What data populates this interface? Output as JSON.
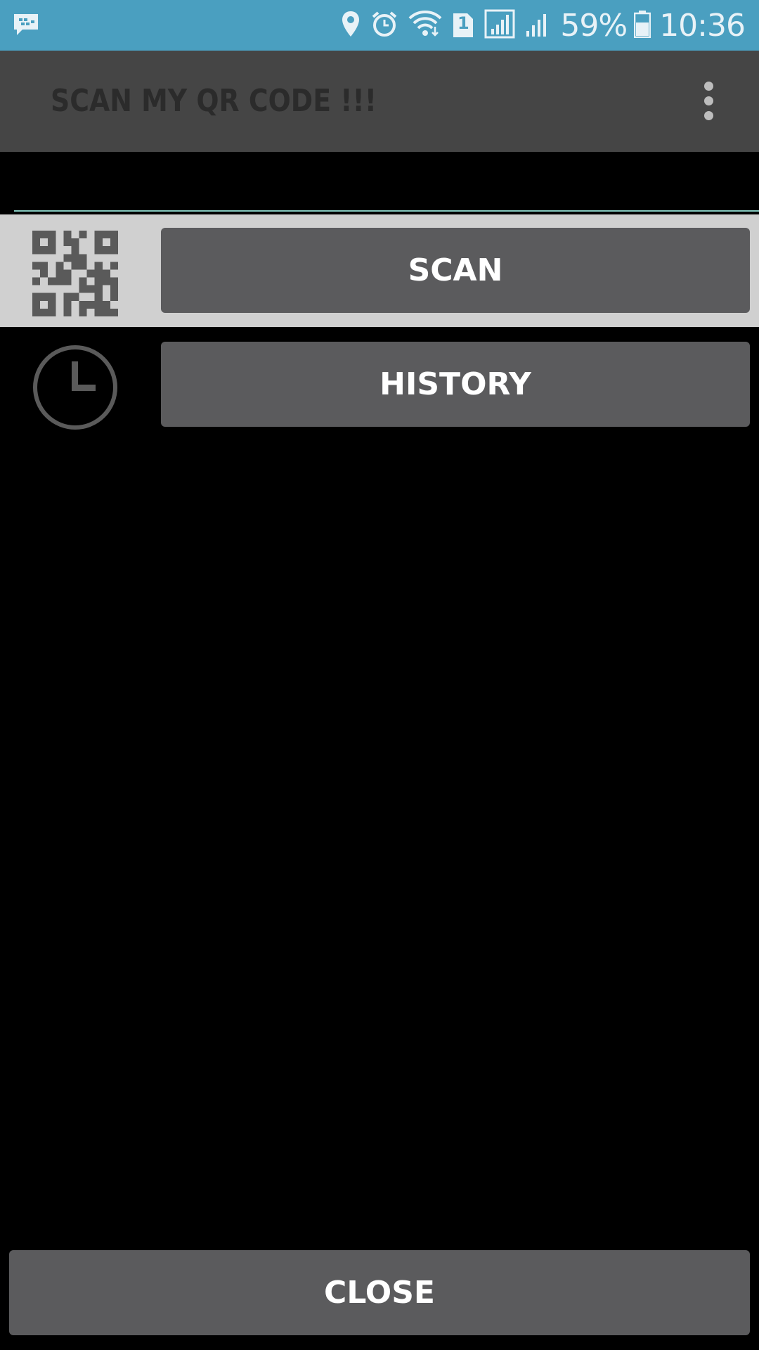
{
  "status_bar": {
    "notification_icon": "bbm-chat-icon",
    "icons": [
      "location-icon",
      "alarm-icon",
      "wifi-icon",
      "sim-1-icon",
      "signal-icon",
      "signal-icon-2",
      "battery-icon"
    ],
    "sim_label": "1",
    "battery": "59%",
    "time": "10:36",
    "background_color": "#4a9fc0"
  },
  "toolbar": {
    "title": "SCAN MY QR CODE !!!",
    "overflow_icon": "more-vert-icon",
    "background_color": "#454545"
  },
  "menu": {
    "items": [
      {
        "icon": "qr-code-icon",
        "label": "SCAN",
        "selected": true
      },
      {
        "icon": "clock-icon",
        "label": "HISTORY",
        "selected": false
      }
    ]
  },
  "footer": {
    "close_label": "CLOSE"
  },
  "colors": {
    "button": "#5b5b5d",
    "selected_row": "#d0d0d0",
    "divider": "#86c9bf",
    "icon": "#5a5a5a"
  }
}
